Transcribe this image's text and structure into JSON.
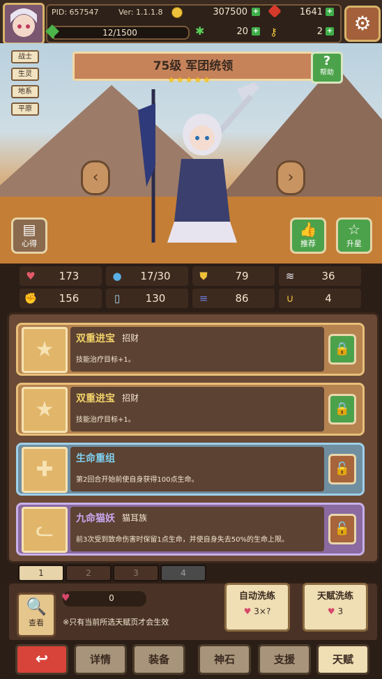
{
  "player": {
    "pid": "PID: 657547",
    "version": "Ver: 1.1.1.8",
    "gold": "307500",
    "gems": "1641",
    "xp": "12/1500",
    "xp_fraction": 0.008,
    "clover": "20",
    "keys": "2"
  },
  "hero": {
    "tags": [
      "战士",
      "生灵",
      "地系",
      "平原"
    ],
    "title": "75级 军团统领",
    "stars": 5,
    "help_label": "帮助",
    "side_left_label": "心得",
    "side_recommend_label": "推荐",
    "side_upgrade_label": "升星"
  },
  "stats": [
    {
      "icon": "heart-icon",
      "value": "173"
    },
    {
      "icon": "water-drop-icon",
      "value": "17/30"
    },
    {
      "icon": "shield-icon",
      "value": "79"
    },
    {
      "icon": "wing-icon",
      "value": "36"
    },
    {
      "icon": "fist-icon",
      "value": "156"
    },
    {
      "icon": "book-icon",
      "value": "130"
    },
    {
      "icon": "scroll-icon",
      "value": "86"
    },
    {
      "icon": "horseshoe-icon",
      "value": "4"
    }
  ],
  "talents": [
    {
      "name": "双重进宝",
      "sub": "招财",
      "desc": "技能治疗目标+1。",
      "locked": true
    },
    {
      "name": "双重进宝",
      "sub": "招财",
      "desc": "技能治疗目标+1。",
      "locked": true
    },
    {
      "name": "生命重组",
      "sub": "",
      "desc": "第2回合开始前使自身获得100点生命。",
      "locked": false
    },
    {
      "name": "九命猫妖",
      "sub": "猫耳族",
      "desc": "前3次受到致命伤害时保留1点生命，并使自身失去50%的生命上限。",
      "locked": false
    }
  ],
  "pages": [
    "1",
    "2",
    "3",
    "4"
  ],
  "reroll": {
    "view_label": "查看",
    "resource": "0",
    "note": "※只有当前所选天赋页才会生效",
    "auto_label": "自动洗练",
    "auto_cost": "3×?",
    "talent_label": "天赋洗练",
    "talent_cost": "3"
  },
  "nav": {
    "back": "back-arrow-icon",
    "items": [
      "详情",
      "装备",
      "神石",
      "支援",
      "天赋"
    ]
  },
  "colors": {
    "gold_frame": "#d9a86a",
    "blue_frame": "#7fb8d6",
    "purple_frame": "#b49ad6",
    "lock_green": "#4ca24a",
    "lock_brown": "#a8643a",
    "back_red": "#d8433a"
  }
}
